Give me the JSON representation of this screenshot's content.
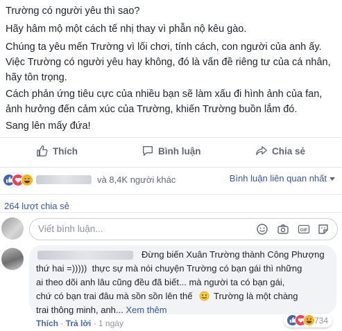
{
  "post": {
    "lines": [
      "Trường có người yêu thì sao?",
      "Hãy hâm mộ một cách tế nhị thay vì phẫn nộ kêu gào.",
      "Chúng ta yêu mến Trường vì lối chơi, tính cách, con người của anh ấy.",
      "Việc Trường có người yêu hay không, đó là vấn đề riêng tư của cá nhân,",
      "hãy tôn trọng.",
      "Cách phản ứng tiêu cực của nhiều bạn sẽ làm xấu đi hình ảnh của fan,",
      "ảnh hưởng đến cảm xúc của Trường, khiến Trường buồn lắm đó.",
      "Sang lên mấy đứa!"
    ]
  },
  "actions": {
    "like": "Thích",
    "comment": "Bình luận",
    "share": "Chia sẻ"
  },
  "reactions": {
    "others": "và 8,4K người khác",
    "sort": "Bình luận liên quan nhất"
  },
  "shares": "264 lượt chia sẻ",
  "composer": {
    "placeholder": "Viết bình luận..."
  },
  "comment": {
    "lines": [
      "Đừng biến Xuân Trường thành Công Phượng",
      "thứ hai =)))))  thực sự mà nói chuyện Trường có bạn gái thì những",
      "ai theo dõi anh lâu cũng đều đã biết... mà người ta có bạn gái,",
      "chứ có bạn trai đâu mà sồn sồn lên thế",
      "Trường là một chàng",
      "trai thông minh, anh..."
    ],
    "see_more": "Xem thêm",
    "like": "Thích",
    "reply": "Trả lời",
    "time": "1 ngày",
    "reaction_count": "734"
  },
  "colors": {
    "like_blue": "#4267b2",
    "love_red": "#f33e58",
    "haha_yellow": "#f7b125",
    "link": "#385898"
  }
}
